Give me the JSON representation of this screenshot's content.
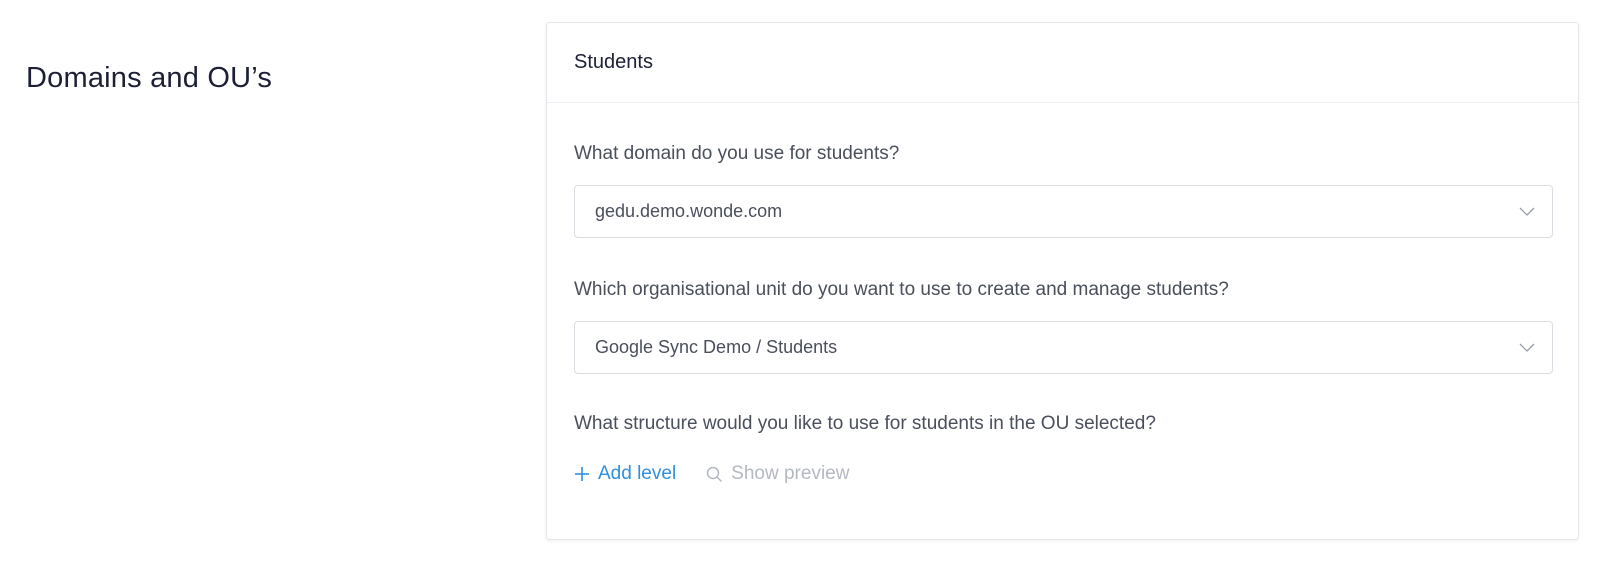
{
  "section": {
    "title": "Domains and OU’s"
  },
  "card": {
    "title": "Students",
    "domain_question": "What domain do you use for students?",
    "domain_value": "gedu.demo.wonde.com",
    "ou_question": "Which organisational unit do you want to use to create and manage students?",
    "ou_value": "Google Sync Demo / Students",
    "structure_question": "What structure would you like to use for students in the OU selected?",
    "add_level_label": "Add level",
    "show_preview_label": "Show preview"
  },
  "icons": {
    "chevron": "chevron-down-icon",
    "plus": "plus-icon",
    "search": "search-icon"
  },
  "colors": {
    "accent": "#2f8fe0",
    "disabled": "#b3b8c2",
    "heading": "#1d2035"
  }
}
